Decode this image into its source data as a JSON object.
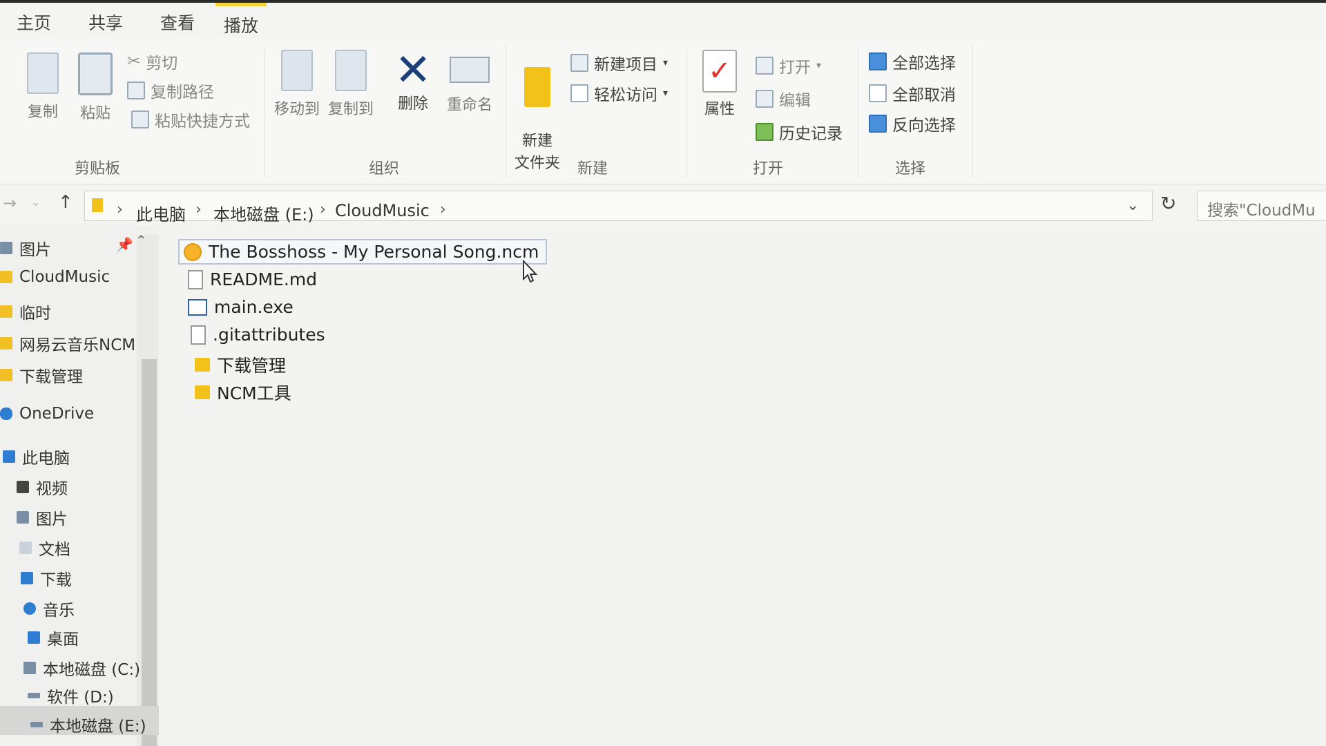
{
  "tabs": [
    "主页",
    "共享",
    "查看",
    "播放"
  ],
  "ribbon": {
    "clipboard": {
      "copy": "复制",
      "paste": "粘贴",
      "cut": "剪切",
      "copy_path": "复制路径",
      "paste_shortcut": "粘贴快捷方式",
      "group": "剪贴板"
    },
    "organize": {
      "move_to": "移动到",
      "copy_to": "复制到",
      "delete": "删除",
      "rename": "重命名",
      "group": "组织"
    },
    "new": {
      "new_folder": "新建\n文件夹",
      "new_item": "新建项目",
      "easy_access": "轻松访问",
      "group": "新建"
    },
    "open": {
      "properties": "属性",
      "open": "打开",
      "edit": "编辑",
      "history": "历史记录",
      "group": "打开"
    },
    "select": {
      "select_all": "全部选择",
      "select_none": "全部取消",
      "invert": "反向选择",
      "group": "选择"
    }
  },
  "address": {
    "crumbs": [
      "此电脑",
      "本地磁盘 (E:)",
      "CloudMusic"
    ],
    "search_placeholder": "搜索\"CloudMu"
  },
  "sidebar": {
    "items": [
      {
        "label": "图片",
        "icon": "folder-icon"
      },
      {
        "label": "CloudMusic",
        "icon": "folder-icon"
      },
      {
        "label": "临时",
        "icon": "folder-icon"
      },
      {
        "label": "网易云音乐NCM",
        "icon": "folder-icon"
      },
      {
        "label": "下载管理",
        "icon": "folder-icon"
      },
      {
        "label": "OneDrive",
        "icon": "cloud-icon"
      },
      {
        "label": "此电脑",
        "icon": "computer-icon"
      },
      {
        "label": "视频",
        "icon": "video-icon"
      },
      {
        "label": "图片",
        "icon": "pictures-icon"
      },
      {
        "label": "文档",
        "icon": "documents-icon"
      },
      {
        "label": "下载",
        "icon": "download-icon"
      },
      {
        "label": "音乐",
        "icon": "music-icon"
      },
      {
        "label": "桌面",
        "icon": "desktop-icon"
      },
      {
        "label": "本地磁盘 (C:)",
        "icon": "drive-icon"
      },
      {
        "label": "软件 (D:)",
        "icon": "drive-icon"
      },
      {
        "label": "本地磁盘 (E:)",
        "icon": "drive-icon"
      }
    ]
  },
  "files": [
    {
      "name": "The Bosshoss - My Personal Song.ncm",
      "icon": "ncm-file-icon"
    },
    {
      "name": "README.md",
      "icon": "document-icon"
    },
    {
      "name": "main.exe",
      "icon": "exe-icon"
    },
    {
      "name": ".gitattributes",
      "icon": "document-icon"
    },
    {
      "name": "下载管理",
      "icon": "folder-icon"
    },
    {
      "name": "NCM工具",
      "icon": "folder-icon"
    }
  ],
  "colors": {
    "accent": "#f2d23a",
    "folder": "#f2c21b",
    "delete_x": "#1c3f7a",
    "check": "#e0302a"
  }
}
